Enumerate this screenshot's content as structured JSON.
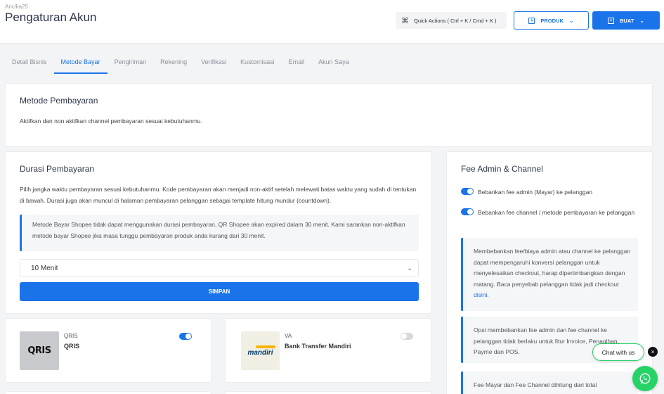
{
  "header": {
    "breadcrumb": "Anclka25",
    "title": "Pengaturan Akun",
    "quick_actions": "Quick Actions ( Ctrl + K / Cmd + K )",
    "produk_label": "PRODUK",
    "buat_label": "BUAT"
  },
  "tabs": [
    {
      "label": "Detail Bisnis",
      "active": false
    },
    {
      "label": "Metode Bayar",
      "active": true
    },
    {
      "label": "Pengiriman",
      "active": false
    },
    {
      "label": "Rekening",
      "active": false
    },
    {
      "label": "Verifikasi",
      "active": false
    },
    {
      "label": "Kustomisasi",
      "active": false
    },
    {
      "label": "Email",
      "active": false
    },
    {
      "label": "Akun Saya",
      "active": false
    }
  ],
  "metode": {
    "title": "Metode Pembayaran",
    "desc": "Aktifkan dan non aktifkan channel pembayaran sesuai kebutuhanmu."
  },
  "durasi": {
    "title": "Durasi Pembayaran",
    "desc": "Pilih jangka waktu pembayaran sesuai kebutuhanmu. Kode pembayaran akan menjadi non-aktif setelah melewati batas waktu yang sudah di tentukan di bawah. Durasi juga akan muncul di halaman pembayaran pelanggan sebagai template hitung mundur (countdown).",
    "notice": "Metode Bayar Shopee tidak dapat menggunakan durasi pembayaran, QR Shopee akan expired dalam 30 menit. Kami sarankan non-aktifkan metode bayar Shopee jika masa tunggu pembayaran produk anda kurang dari 30 menit.",
    "select_value": "10 Menit",
    "save_label": "SIMPAN"
  },
  "channels": [
    {
      "type": "QRIS",
      "name": "QRIS",
      "logo": "QRIS",
      "enabled": true
    },
    {
      "type": "VA",
      "name": "Bank Transfer Mandiri",
      "logo": "mandiri",
      "enabled": false
    }
  ],
  "fee": {
    "title": "Fee Admin & Channel",
    "toggle1": "Bebankan fee admin (Mayar) ke pelanggan",
    "toggle2": "Bebankan fee channel / metode pembayaran ke pelanggan",
    "note1_text": "Membebankan fee/biaya admin atau channel ke pelanggan dapat mempengaruhi konversi pelanggan untuk menyelesaikan checkout, harap dipertimbangkan dengan matang. Baca penyebab pelanggan tidak jadi checkout",
    "note1_link": "disini.",
    "note2": "Opsi membebankan fee admin dan fee channel ke pelanggan tidak berlaku untuk fitur Invoice, Penagihan, Payme dan POS.",
    "note3": "Fee Mayar dan Fee Channel dihitung dari total"
  },
  "chat": {
    "label": "Chat with us"
  },
  "colors": {
    "primary": "#1a73e8",
    "whatsapp": "#25d366"
  }
}
